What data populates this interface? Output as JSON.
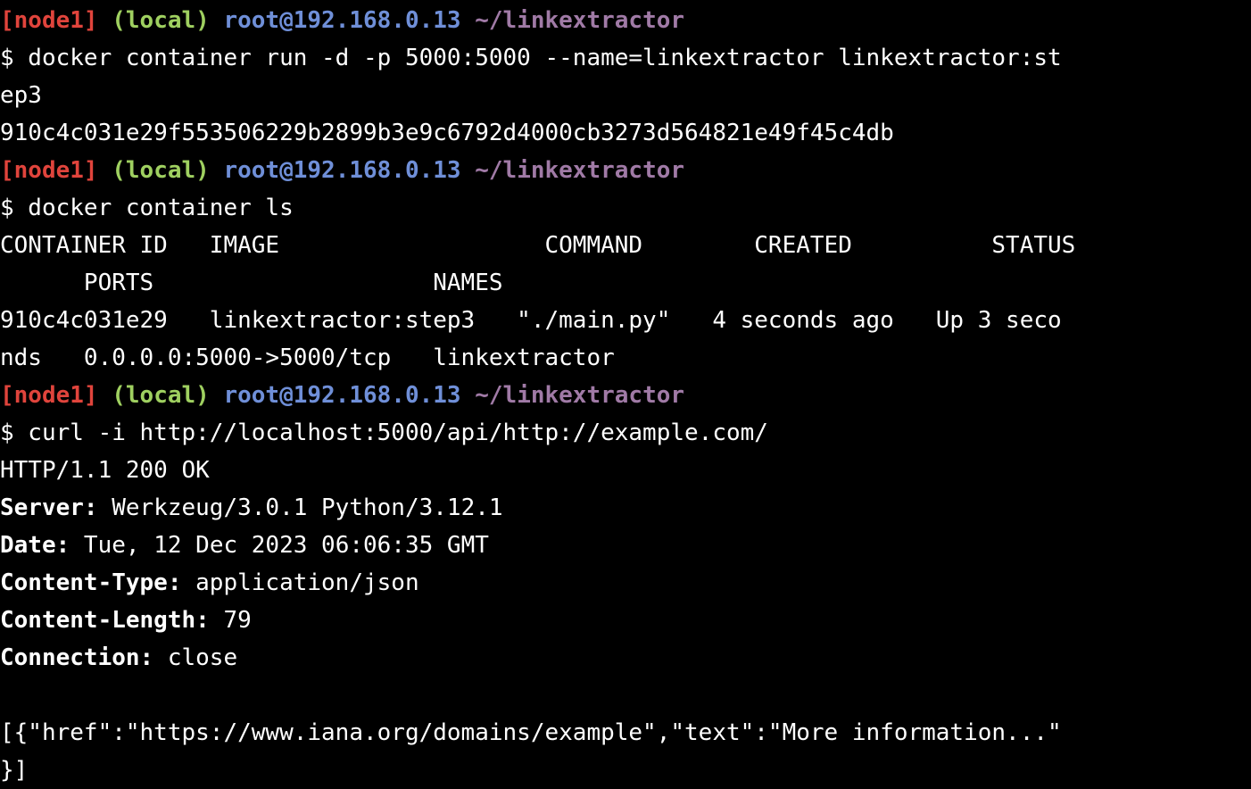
{
  "colors": {
    "background": "#000000",
    "text": "#ffffff",
    "prompt_node": "#e0443c",
    "prompt_env": "#9fd060",
    "prompt_user_host": "#6f8fd8",
    "prompt_path": "#a07aa6"
  },
  "prompt": {
    "node": "[node1]",
    "env": "(local)",
    "user_host": "root@192.168.0.13",
    "path": "~/linkextractor"
  },
  "lines": {
    "l1": "$ docker container run -d -p 5000:5000 --name=linkextractor linkextractor:st",
    "l2": "ep3",
    "l3": "910c4c031e29f553506229b2899b3e9c6792d4000cb3273d564821e49f45c4db",
    "l5": "$ docker container ls",
    "l6": "CONTAINER ID   IMAGE                   COMMAND        CREATED          STATUS",
    "l7": "      PORTS                    NAMES",
    "l8": "910c4c031e29   linkextractor:step3   \"./main.py\"   4 seconds ago   Up 3 seco",
    "l9": "nds   0.0.0.0:5000->5000/tcp   linkextractor",
    "l11": "$ curl -i http://localhost:5000/api/http://example.com/",
    "l12": "HTTP/1.1 200 OK",
    "l17": "",
    "l18": "[{\"href\":\"https://www.iana.org/domains/example\",\"text\":\"More information...\"",
    "l19": "}]"
  },
  "headers": {
    "server_key": "Server:",
    "server_val": " Werkzeug/3.0.1 Python/3.12.1",
    "date_key": "Date:",
    "date_val": " Tue, 12 Dec 2023 06:06:35 GMT",
    "ctype_key": "Content-Type:",
    "ctype_val": " application/json",
    "clen_key": "Content-Length:",
    "clen_val": " 79",
    "conn_key": "Connection:",
    "conn_val": " close"
  }
}
